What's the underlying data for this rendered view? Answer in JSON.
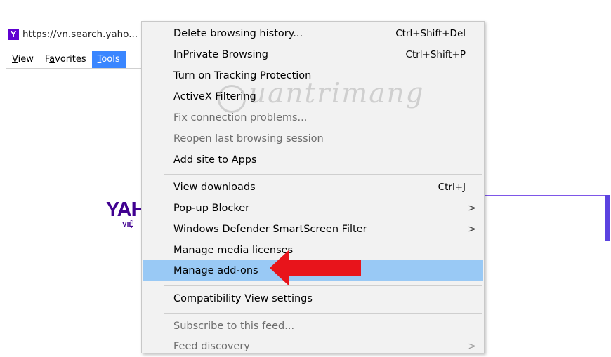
{
  "address_bar": {
    "favicon": "yahoo-favicon",
    "favicon_letter": "Y",
    "url": "https://vn.search.yaho..."
  },
  "menubar": {
    "items": [
      {
        "label": "View",
        "accel": "V"
      },
      {
        "label": "Favorites",
        "accel": "a"
      },
      {
        "label": "Tools",
        "accel": "T",
        "active": true
      }
    ]
  },
  "page": {
    "logo_text": "YAH",
    "logo_sub": "VIỆ"
  },
  "watermark": {
    "text": "uantrimang"
  },
  "tools_menu": {
    "items": [
      {
        "label": "Delete browsing history...",
        "shortcut": "Ctrl+Shift+Del"
      },
      {
        "label": "InPrivate Browsing",
        "shortcut": "Ctrl+Shift+P"
      },
      {
        "label": "Turn on Tracking Protection",
        "shortcut": ""
      },
      {
        "label": "ActiveX Filtering",
        "shortcut": ""
      },
      {
        "label": "Fix connection problems...",
        "shortcut": "",
        "disabled": true
      },
      {
        "label": "Reopen last browsing session",
        "shortcut": "",
        "disabled": true
      },
      {
        "label": "Add site to Apps",
        "shortcut": ""
      },
      {
        "label": "View downloads",
        "shortcut": "Ctrl+J"
      },
      {
        "label": "Pop-up Blocker",
        "shortcut": "",
        "submenu": true
      },
      {
        "label": "Windows Defender SmartScreen Filter",
        "shortcut": "",
        "submenu": true
      },
      {
        "label": "Manage media licenses",
        "shortcut": ""
      },
      {
        "label": "Manage add-ons",
        "shortcut": "",
        "highlighted": true
      },
      {
        "label": "Compatibility View settings",
        "shortcut": ""
      },
      {
        "label": "Subscribe to this feed...",
        "shortcut": "",
        "disabled": true
      },
      {
        "label": "Feed discovery",
        "shortcut": "",
        "disabled": true,
        "submenu": true
      }
    ],
    "submenu_glyph": ">"
  },
  "colors": {
    "menu_bg": "#f2f2f2",
    "highlight": "#99c9f5",
    "active_menubar": "#3a86ff",
    "yahoo_purple": "#400090",
    "annotation_red": "#e8141b"
  }
}
